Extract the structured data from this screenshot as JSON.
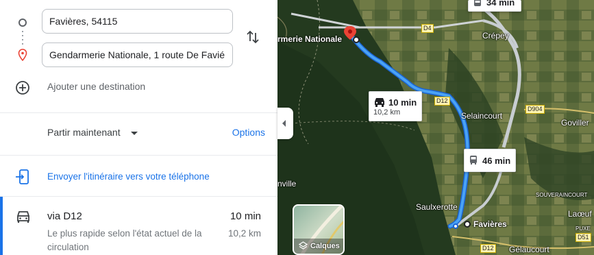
{
  "directions": {
    "origin_value": "Favières, 54115",
    "destination_value": "Gendarmerie Nationale, 1 route De Favié",
    "add_destination_label": "Ajouter une destination",
    "leave_now_label": "Partir maintenant",
    "options_label": "Options",
    "send_to_phone_label": "Envoyer l'itinéraire vers votre téléphone"
  },
  "routes": [
    {
      "via": "via D12",
      "duration": "10 min",
      "description": "Le plus rapide selon l'état actuel de la circulation",
      "distance": "10,2 km"
    }
  ],
  "map": {
    "route_bubble": {
      "duration": "10 min",
      "distance": "10,2 km"
    },
    "transit_bubbles": [
      "34 min",
      "46 min"
    ],
    "places": [
      "rmerie Nationale",
      "Crépey",
      "Selaincourt",
      "Goviller",
      "Saulxerotte",
      "Favières",
      "Laœuf",
      "Gélaucourt",
      "nville"
    ],
    "small_labels": [
      "SOUVERAINCOURT",
      "PUXE"
    ],
    "roads": [
      "D4",
      "D12",
      "D904",
      "D12",
      "D51"
    ],
    "layers_label": "Calques",
    "route_color": "#4285f4"
  }
}
